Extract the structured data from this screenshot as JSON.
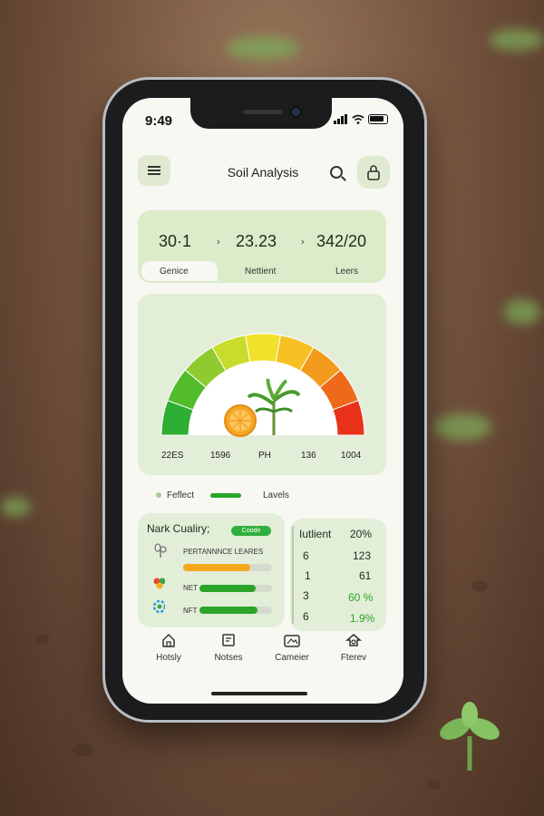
{
  "status_bar": {
    "time": "9:49"
  },
  "header": {
    "title": "Soil Analysis"
  },
  "stats": {
    "values": [
      "30·1",
      "23.23",
      "342/20"
    ],
    "labels": [
      "Genice",
      "Nettient",
      "Leers"
    ]
  },
  "gauge": {
    "labels": [
      "22ES",
      "1596",
      "PH",
      "136",
      "1004"
    ],
    "segment_colors": [
      "#2eae33",
      "#53bc2c",
      "#8fcb2e",
      "#c7dc2b",
      "#f2e12a",
      "#f6c022",
      "#f39b1c",
      "#ee6a1a",
      "#e8321a"
    ]
  },
  "legend": {
    "items": [
      "Feflect",
      "Lavels"
    ]
  },
  "quality": {
    "title": "Nark Cualiry;",
    "badge": "Coode",
    "rows": [
      {
        "label": "PERTANNNCE LEARES",
        "icon": "sprout-icon",
        "fill": 0.75,
        "color": "#f4a81d"
      },
      {
        "label": "NET",
        "icon": "leaf-cluster-icon",
        "fill": 0.78,
        "color": "#2aa52a"
      },
      {
        "label": "NFT",
        "icon": "flower-icon",
        "fill": 0.8,
        "color": "#2aa52a"
      }
    ]
  },
  "nutrients": {
    "header": [
      "Iutlient",
      "20%"
    ],
    "rows": [
      [
        "6",
        "123"
      ],
      [
        "1",
        "61"
      ],
      [
        "3",
        "60 %"
      ],
      [
        "6",
        "1.9%"
      ]
    ]
  },
  "tabs": [
    {
      "label": "Hotsly",
      "icon": "home-icon"
    },
    {
      "label": "Notses",
      "icon": "notes-icon"
    },
    {
      "label": "Cameier",
      "icon": "camera-icon"
    },
    {
      "label": "Fterev",
      "icon": "settings-icon"
    }
  ]
}
